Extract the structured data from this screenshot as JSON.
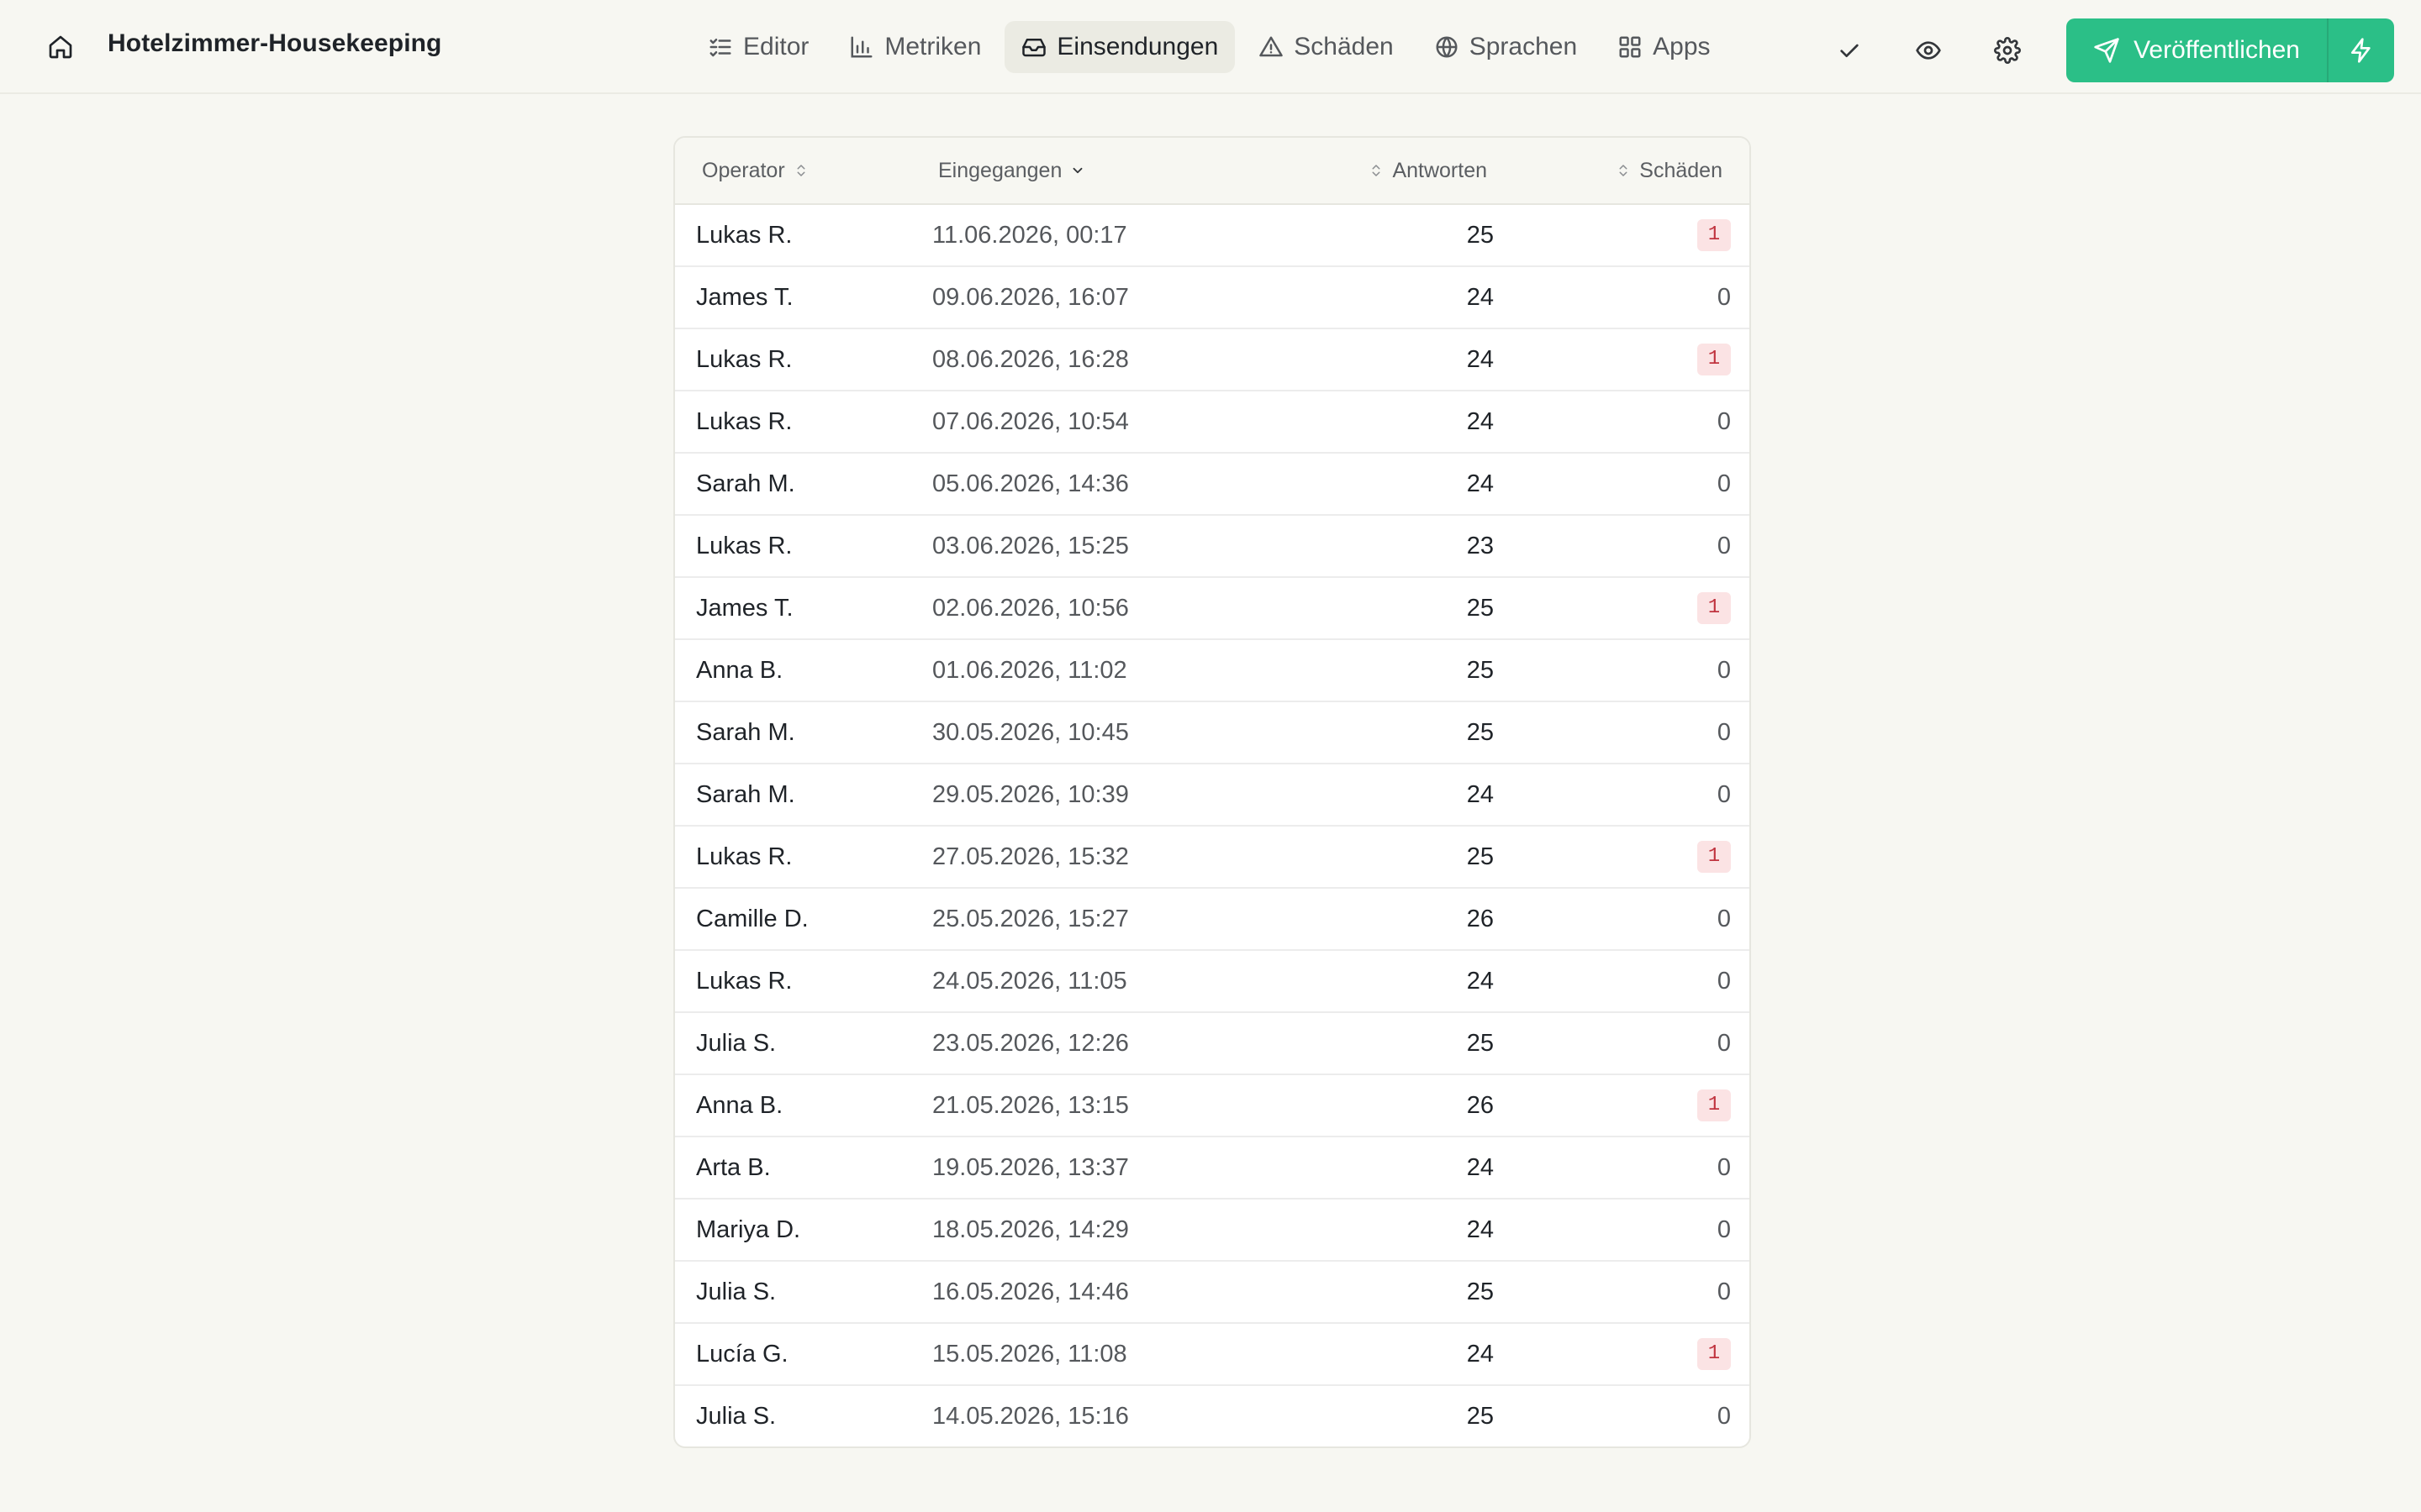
{
  "header": {
    "title": "Hotelzimmer-Housekeeping",
    "tabs": [
      {
        "label": "Editor",
        "icon": "list-check-icon",
        "active": false
      },
      {
        "label": "Metriken",
        "icon": "bar-chart-icon",
        "active": false
      },
      {
        "label": "Einsendungen",
        "icon": "inbox-icon",
        "active": true
      },
      {
        "label": "Schäden",
        "icon": "warning-triangle-icon",
        "active": false
      },
      {
        "label": "Sprachen",
        "icon": "globe-icon",
        "active": false
      },
      {
        "label": "Apps",
        "icon": "grid-icon",
        "active": false
      }
    ],
    "publish_label": "Veröffentlichen",
    "accent_color": "#2bbf87"
  },
  "table": {
    "columns": {
      "operator": "Operator",
      "received": "Eingegangen",
      "answers": "Antworten",
      "damages": "Schäden"
    },
    "sort": {
      "column": "received",
      "direction": "desc"
    },
    "rows": [
      {
        "operator": "Lukas R.",
        "received": "11.06.2026, 00:17",
        "answers": "25",
        "damages": "1"
      },
      {
        "operator": "James T.",
        "received": "09.06.2026, 16:07",
        "answers": "24",
        "damages": "0"
      },
      {
        "operator": "Lukas R.",
        "received": "08.06.2026, 16:28",
        "answers": "24",
        "damages": "1"
      },
      {
        "operator": "Lukas R.",
        "received": "07.06.2026, 10:54",
        "answers": "24",
        "damages": "0"
      },
      {
        "operator": "Sarah M.",
        "received": "05.06.2026, 14:36",
        "answers": "24",
        "damages": "0"
      },
      {
        "operator": "Lukas R.",
        "received": "03.06.2026, 15:25",
        "answers": "23",
        "damages": "0"
      },
      {
        "operator": "James T.",
        "received": "02.06.2026, 10:56",
        "answers": "25",
        "damages": "1"
      },
      {
        "operator": "Anna B.",
        "received": "01.06.2026, 11:02",
        "answers": "25",
        "damages": "0"
      },
      {
        "operator": "Sarah M.",
        "received": "30.05.2026, 10:45",
        "answers": "25",
        "damages": "0"
      },
      {
        "operator": "Sarah M.",
        "received": "29.05.2026, 10:39",
        "answers": "24",
        "damages": "0"
      },
      {
        "operator": "Lukas R.",
        "received": "27.05.2026, 15:32",
        "answers": "25",
        "damages": "1"
      },
      {
        "operator": "Camille D.",
        "received": "25.05.2026, 15:27",
        "answers": "26",
        "damages": "0"
      },
      {
        "operator": "Lukas R.",
        "received": "24.05.2026, 11:05",
        "answers": "24",
        "damages": "0"
      },
      {
        "operator": "Julia S.",
        "received": "23.05.2026, 12:26",
        "answers": "25",
        "damages": "0"
      },
      {
        "operator": "Anna B.",
        "received": "21.05.2026, 13:15",
        "answers": "26",
        "damages": "1"
      },
      {
        "operator": "Arta B.",
        "received": "19.05.2026, 13:37",
        "answers": "24",
        "damages": "0"
      },
      {
        "operator": "Mariya D.",
        "received": "18.05.2026, 14:29",
        "answers": "24",
        "damages": "0"
      },
      {
        "operator": "Julia S.",
        "received": "16.05.2026, 14:46",
        "answers": "25",
        "damages": "0"
      },
      {
        "operator": "Lucía G.",
        "received": "15.05.2026, 11:08",
        "answers": "24",
        "damages": "1"
      },
      {
        "operator": "Julia S.",
        "received": "14.05.2026, 15:16",
        "answers": "25",
        "damages": "0"
      }
    ]
  }
}
